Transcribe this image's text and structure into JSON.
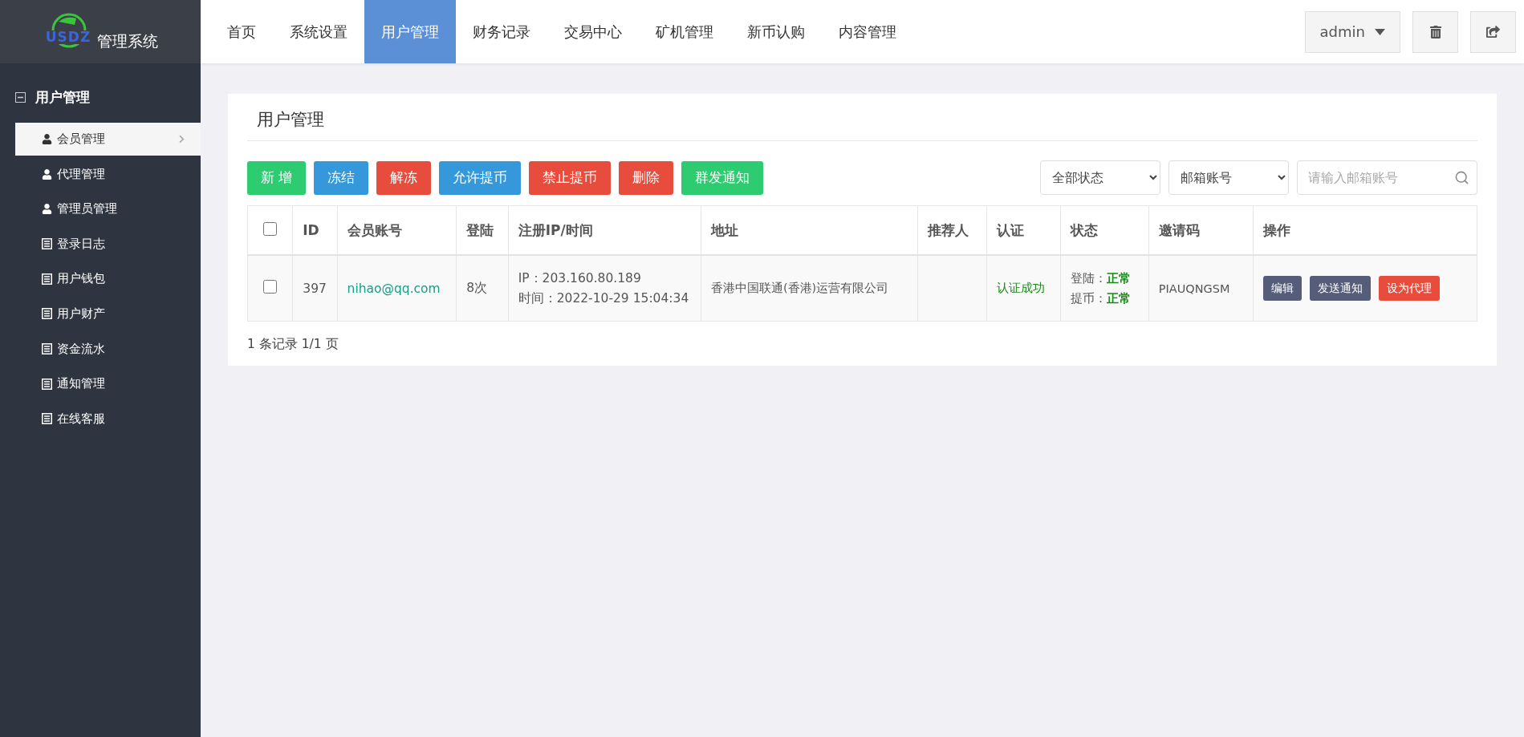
{
  "logo": {
    "mark": "USDZ",
    "title": "管理系统"
  },
  "nav": [
    {
      "label": "首页",
      "selected": false
    },
    {
      "label": "系统设置",
      "selected": false
    },
    {
      "label": "用户管理",
      "selected": true
    },
    {
      "label": "财务记录",
      "selected": false
    },
    {
      "label": "交易中心",
      "selected": false
    },
    {
      "label": "矿机管理",
      "selected": false
    },
    {
      "label": "新币认购",
      "selected": false
    },
    {
      "label": "内容管理",
      "selected": false
    }
  ],
  "user_menu": {
    "label": "admin"
  },
  "sidebar": {
    "group": {
      "label": "用户管理",
      "expanded": true
    },
    "items": [
      {
        "label": "会员管理",
        "kind": "user",
        "selected": true
      },
      {
        "label": "代理管理",
        "kind": "user",
        "selected": false
      },
      {
        "label": "管理员管理",
        "kind": "user",
        "selected": false
      },
      {
        "label": "登录日志",
        "kind": "list",
        "selected": false
      },
      {
        "label": "用户钱包",
        "kind": "list",
        "selected": false
      },
      {
        "label": "用户财产",
        "kind": "list",
        "selected": false
      },
      {
        "label": "资金流水",
        "kind": "list",
        "selected": false
      },
      {
        "label": "通知管理",
        "kind": "list",
        "selected": false
      },
      {
        "label": "在线客服",
        "kind": "list",
        "selected": false
      }
    ]
  },
  "page_title": "用户管理",
  "toolbar": [
    {
      "label": "新 增",
      "color": "#2ecc71"
    },
    {
      "label": "冻结",
      "color": "#3498db"
    },
    {
      "label": "解冻",
      "color": "#e74c3c"
    },
    {
      "label": "允许提币",
      "color": "#3498db"
    },
    {
      "label": "禁止提币",
      "color": "#e74c3c"
    },
    {
      "label": "删除",
      "color": "#e74c3c"
    },
    {
      "label": "群发通知",
      "color": "#2ecc71"
    }
  ],
  "filters": [
    {
      "value": "全部状态"
    },
    {
      "value": "邮箱账号"
    }
  ],
  "search": {
    "placeholder": "请输入邮箱账号"
  },
  "table": {
    "all_checked": false,
    "columns": [
      "ID",
      "会员账号",
      "登陆",
      "注册IP/时间",
      "地址",
      "推荐人",
      "认证",
      "状态",
      "邀请码",
      "操作"
    ],
    "rows": [
      {
        "checked": false,
        "id": "397",
        "account": "nihao@qq.com",
        "logins": "8次",
        "ip": "IP：203.160.80.189",
        "time": "时间：2022-10-29 15:04:34",
        "address": "香港中国联通(香港)运营有限公司",
        "auth": "认证成功",
        "statuses": [
          {
            "label": "登陆：",
            "value": "正常"
          },
          {
            "label": "提币：",
            "value": "正常"
          }
        ],
        "invite_code": "PIAUQNGSM",
        "actions": [
          {
            "label": "编辑",
            "color": "#555d79"
          },
          {
            "label": "发送通知",
            "color": "#555d79"
          },
          {
            "label": "设为代理",
            "color": "#e74c3c"
          }
        ]
      }
    ]
  },
  "pagination": "1 条记录 1/1 页"
}
